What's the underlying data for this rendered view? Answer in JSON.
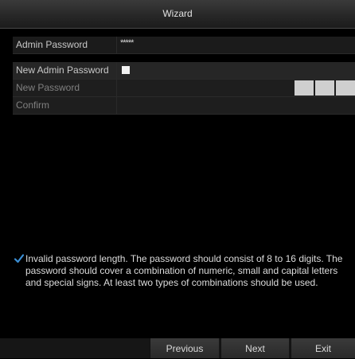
{
  "window": {
    "title": "Wizard"
  },
  "form": {
    "admin_password": {
      "label": "Admin Password",
      "value": "*****"
    },
    "new_admin_password": {
      "label": "New Admin Password",
      "checked": true
    },
    "new_password": {
      "label": "New Password",
      "strength_blocks": 3
    },
    "confirm": {
      "label": "Confirm",
      "value": ""
    }
  },
  "notice": {
    "icon": "checkmark-icon",
    "text": "Invalid password length. The password should consist of 8 to 16 digits. The password should cover a combination of numeric, small and capital letters and special signs. At least two types of combinations should be used."
  },
  "footer": {
    "previous_label": "Previous",
    "next_label": "Next",
    "exit_label": "Exit"
  }
}
